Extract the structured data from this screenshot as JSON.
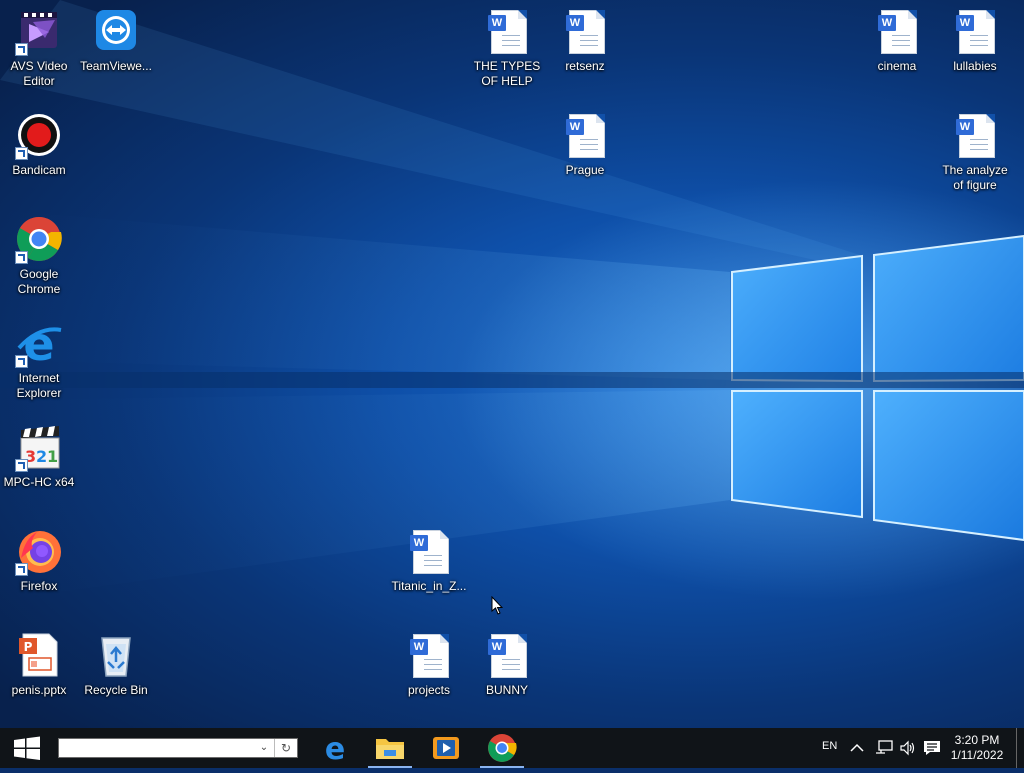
{
  "desktop": {
    "icons": [
      {
        "id": "avs",
        "label": "AVS Video Editor"
      },
      {
        "id": "teamviewer",
        "label": "TeamViewe..."
      },
      {
        "id": "bandicam",
        "label": "Bandicam"
      },
      {
        "id": "chrome",
        "label": "Google Chrome"
      },
      {
        "id": "ie",
        "label": "Internet Explorer"
      },
      {
        "id": "mpc",
        "label": "MPC-HC x64"
      },
      {
        "id": "firefox",
        "label": "Firefox"
      },
      {
        "id": "pptx",
        "label": "penis.pptx"
      },
      {
        "id": "recycle",
        "label": "Recycle Bin"
      },
      {
        "id": "types_help",
        "label": "THE TYPES OF HELP"
      },
      {
        "id": "retsenz",
        "label": "retsenz"
      },
      {
        "id": "prague",
        "label": "Prague"
      },
      {
        "id": "cinema",
        "label": "cinema"
      },
      {
        "id": "lullabies",
        "label": "lullabies"
      },
      {
        "id": "analyze",
        "label": "The analyze of figure"
      },
      {
        "id": "titanic",
        "label": "Titanic_in_Z..."
      },
      {
        "id": "projects",
        "label": "projects"
      },
      {
        "id": "bunny",
        "label": "BUNNY"
      }
    ]
  },
  "taskbar": {
    "search_value": "",
    "pinned": [
      "edge-icon",
      "file-explorer-icon",
      "media-player-icon",
      "chrome-icon"
    ],
    "tray": {
      "language": "EN",
      "time": "3:20 PM",
      "date": "1/11/2022"
    }
  },
  "colors": {
    "taskbar": "#101418",
    "word_blue": "#2f6bd7",
    "wallpaper_light": "#7fc8ff"
  }
}
